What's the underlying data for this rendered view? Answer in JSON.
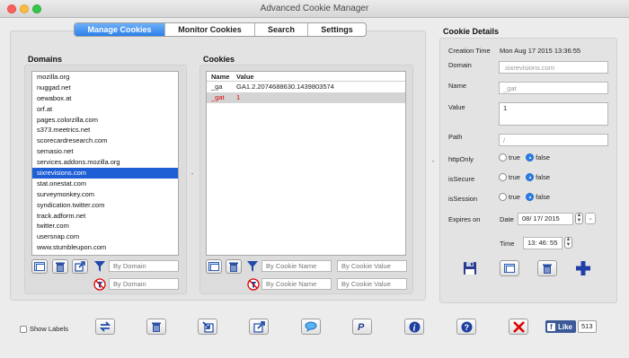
{
  "window": {
    "title": "Advanced Cookie Manager"
  },
  "tabs": [
    {
      "label": "Manage Cookies",
      "active": true
    },
    {
      "label": "Monitor Cookies",
      "active": false
    },
    {
      "label": "Search",
      "active": false
    },
    {
      "label": "Settings",
      "active": false
    }
  ],
  "domains": {
    "header": "Domains",
    "items": [
      "mozilla.org",
      "nuggad.net",
      "oewabox.at",
      "orf.at",
      "pages.colorzilla.com",
      "s373.meetrics.net",
      "scorecardresearch.com",
      "semasio.net",
      "services.addons.mozilla.org",
      "sixrevisions.com",
      "stat.onestat.com",
      "surveymonkey.com",
      "syndication.twitter.com",
      "track.adform.net",
      "twitter.com",
      "usersnap.com",
      "www.stumbleupon.com"
    ],
    "selected_index": 9,
    "filter_placeholder": "By Domain",
    "exclude_placeholder": "By Domain"
  },
  "cookies": {
    "header": "Cookies",
    "columns": [
      "Name",
      "Value"
    ],
    "rows": [
      {
        "name": "_ga",
        "value": "GA1.2.2074688630.1439803574"
      },
      {
        "name": "_gat",
        "value": "1"
      }
    ],
    "name_placeholder": "By Cookie Name",
    "value_placeholder": "By Cookie Value",
    "exclude_name_placeholder": "By Cookie Name",
    "exclude_value_placeholder": "By Cookie Value"
  },
  "details": {
    "header": "Cookie Details",
    "creation_label": "Creation Time",
    "creation_value": "Mon Aug 17 2015 13:36:55",
    "domain_label": "Domain",
    "domain_value": ".sixrevisions.com",
    "name_label": "Name",
    "name_value": "_gat",
    "value_label": "Value",
    "value_value": "1",
    "path_label": "Path",
    "path_value": "/",
    "httponly_label": "httpOnly",
    "issecure_label": "isSecure",
    "issession_label": "isSession",
    "true_label": "true",
    "false_label": "false",
    "expires_label": "Expires on",
    "date_label": "Date",
    "date_value": "08/ 17/ 2015",
    "time_label": "Time",
    "time_value": "13: 46: 55"
  },
  "bottom": {
    "show_labels": "Show Labels",
    "like_label": "Like",
    "like_count": "513"
  },
  "colors": {
    "accent": "#2a80ea",
    "selection": "#1f5fd6",
    "delete_red": "#d00000",
    "icon_blue": "#1e4aa8"
  }
}
